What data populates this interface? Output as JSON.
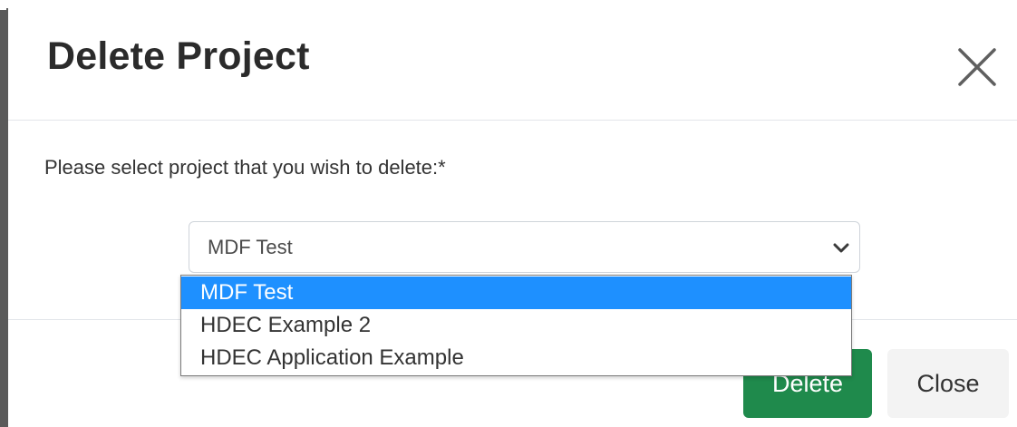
{
  "modal": {
    "title": "Delete Project",
    "close_icon": "close-icon"
  },
  "body": {
    "prompt": "Please select project that you wish to delete:*"
  },
  "project_select": {
    "selected_value": "MDF Test",
    "chevron_icon": "chevron-down-icon",
    "options": [
      {
        "label": "MDF Test",
        "selected": true
      },
      {
        "label": "HDEC Example 2",
        "selected": false
      },
      {
        "label": "HDEC Application Example",
        "selected": false
      }
    ],
    "highlight_color": "#1e90ff"
  },
  "footer": {
    "delete_label": "Delete",
    "close_label": "Close",
    "delete_color": "#1f8a4c"
  }
}
